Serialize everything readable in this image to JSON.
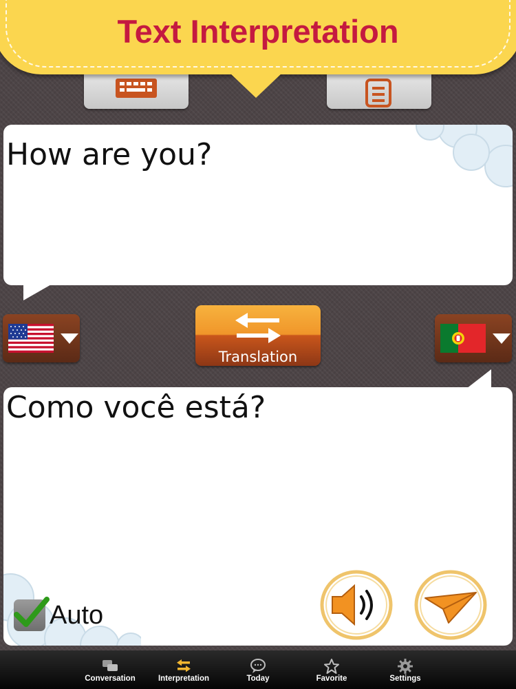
{
  "header": {
    "title": "Text Interpretation"
  },
  "top_tabs": [
    {
      "icon": "keyboard-icon"
    },
    {
      "icon": "clipboard-icon"
    }
  ],
  "source": {
    "text": "How are you?",
    "language_flag": "us-flag-icon"
  },
  "target": {
    "text": "Como você está?",
    "language_flag": "portugal-flag-icon"
  },
  "translate_button": {
    "label": "Translation",
    "icon": "swap-arrows-icon"
  },
  "auto": {
    "label": "Auto",
    "checked": true
  },
  "actions": {
    "speak_icon": "speaker-icon",
    "send_icon": "paper-plane-icon"
  },
  "tabbar": {
    "items": [
      {
        "label": "Conversation",
        "icon": "chat-bubbles-icon",
        "active": false
      },
      {
        "label": "Interpretation",
        "icon": "swap-arrows-icon",
        "active": true
      },
      {
        "label": "Today",
        "icon": "speech-bubble-icon",
        "active": false
      },
      {
        "label": "Favorite",
        "icon": "star-icon",
        "active": false
      },
      {
        "label": "Settings",
        "icon": "gear-icon",
        "active": false
      }
    ]
  },
  "colors": {
    "banner": "#fbd64f",
    "title": "#c41a40",
    "accent_orange": "#f0962a",
    "active_tab_icon": "#f2b630"
  }
}
